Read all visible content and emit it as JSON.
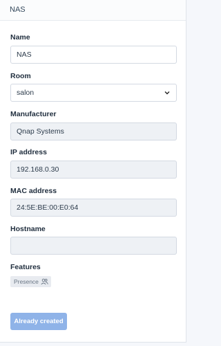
{
  "header": {
    "title": "NAS"
  },
  "form": {
    "name": {
      "label": "Name",
      "value": "NAS"
    },
    "room": {
      "label": "Room",
      "value": "salon"
    },
    "manufacturer": {
      "label": "Manufacturer",
      "value": "Qnap Systems"
    },
    "ip": {
      "label": "IP address",
      "value": "192.168.0.30"
    },
    "mac": {
      "label": "MAC address",
      "value": "24:5E:BE:00:E0:64"
    },
    "hostname": {
      "label": "Hostname",
      "value": ""
    },
    "features": {
      "label": "Features",
      "items": [
        {
          "label": "Presence",
          "icon": "users-icon"
        }
      ]
    }
  },
  "actions": {
    "submit_label": "Already created"
  },
  "colors": {
    "button": "#8fb3e8",
    "readonly_field": "#eef1f5",
    "badge": "#e8ebf0"
  }
}
